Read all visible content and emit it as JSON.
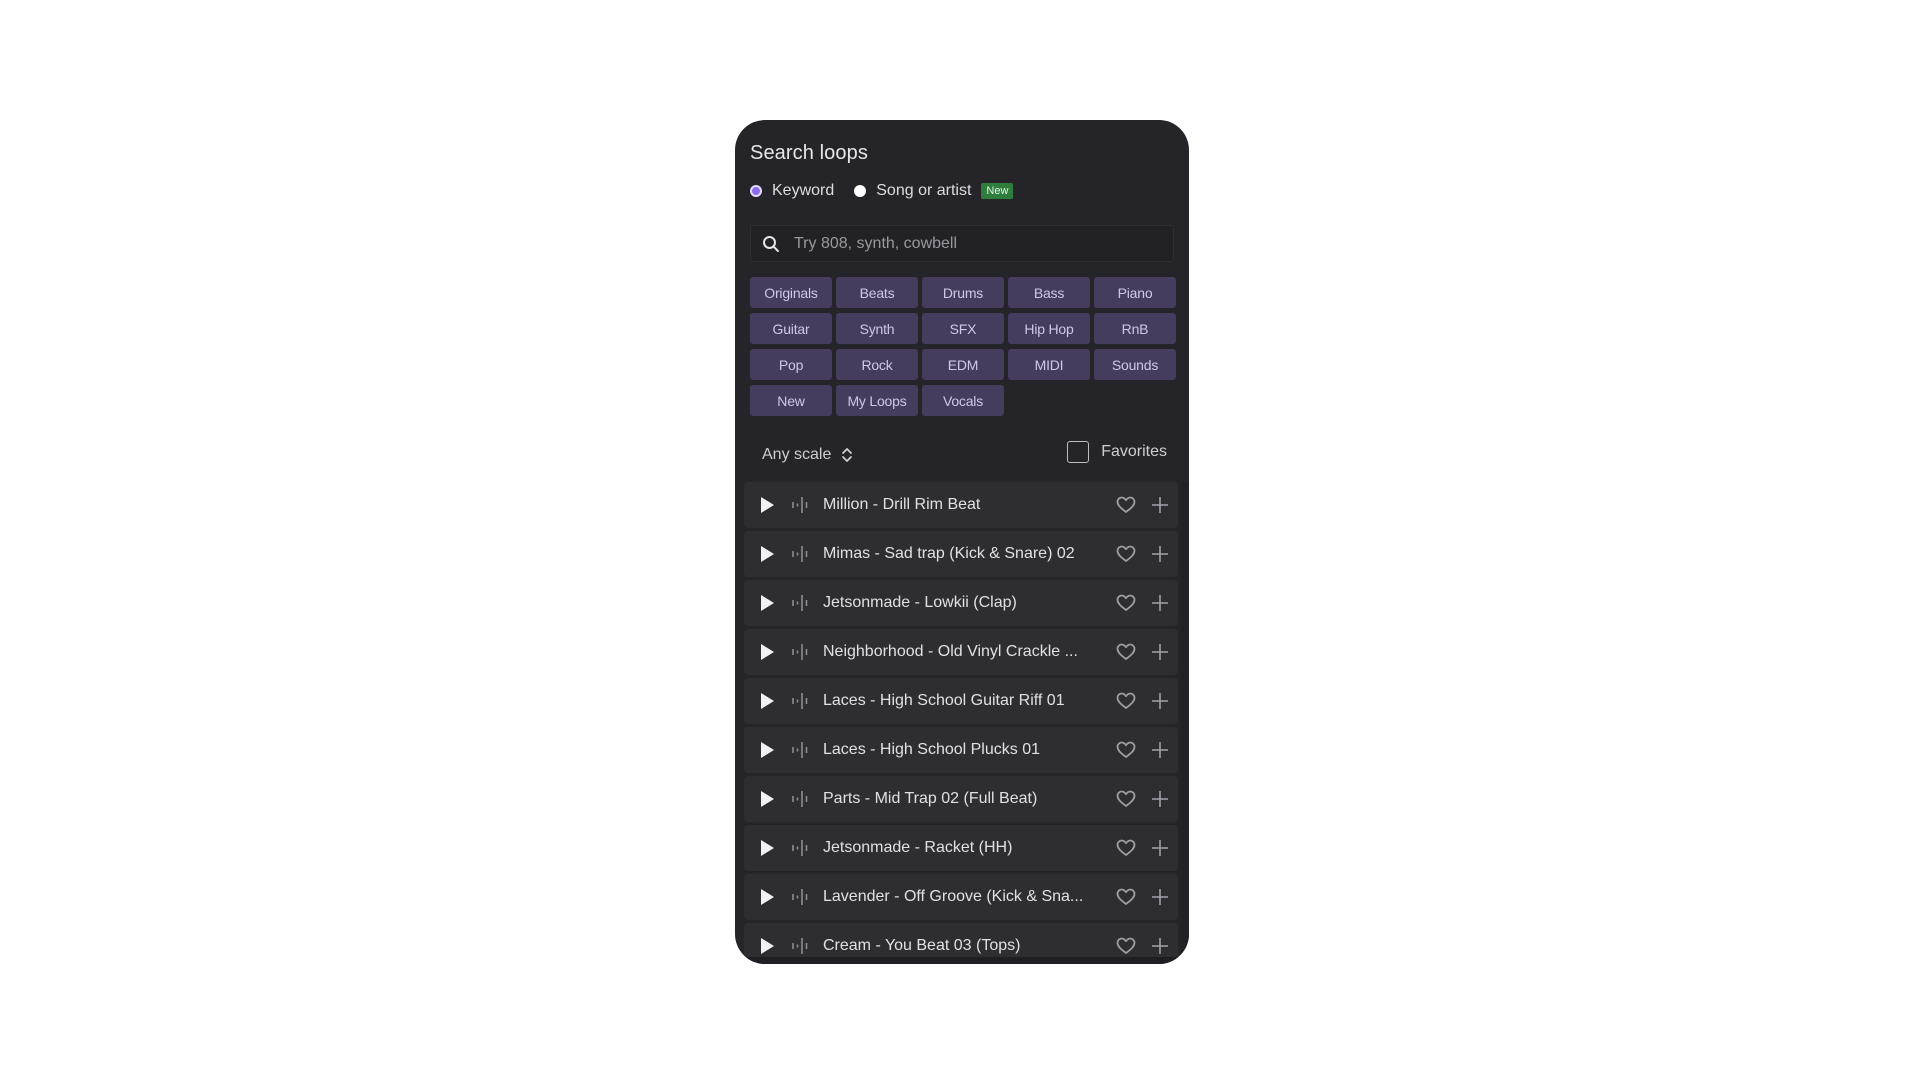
{
  "title": "Search loops",
  "search_mode": {
    "options": [
      {
        "label": "Keyword",
        "selected": true
      },
      {
        "label": "Song or artist",
        "selected": false
      }
    ],
    "new_badge": "New"
  },
  "search": {
    "placeholder": "Try 808, synth, cowbell",
    "value": "",
    "icon": "search-icon"
  },
  "categories": [
    "Originals",
    "Beats",
    "Drums",
    "Bass",
    "Piano",
    "Guitar",
    "Synth",
    "SFX",
    "Hip Hop",
    "RnB",
    "Pop",
    "Rock",
    "EDM",
    "MIDI",
    "Sounds",
    "New",
    "My Loops",
    "Vocals"
  ],
  "filters": {
    "scale_label": "Any scale",
    "favorites_label": "Favorites",
    "favorites_checked": false
  },
  "loops": [
    {
      "name": "Million - Drill Rim Beat"
    },
    {
      "name": "Mimas - Sad trap (Kick & Snare) 02"
    },
    {
      "name": "Jetsonmade - Lowkii (Clap)"
    },
    {
      "name": "Neighborhood - Old Vinyl Crackle ..."
    },
    {
      "name": "Laces - High School Guitar Riff 01"
    },
    {
      "name": "Laces - High School Plucks 01"
    },
    {
      "name": "Parts - Mid Trap 02 (Full Beat)"
    },
    {
      "name": "Jetsonmade - Racket (HH)"
    },
    {
      "name": "Lavender - Off Groove (Kick & Sna..."
    },
    {
      "name": "Cream - You Beat 03 (Tops)"
    }
  ],
  "colors": {
    "panel_bg": "#252429",
    "row_bg": "#2e2d32",
    "chip_bg": "#463d5e",
    "chip_text": "#cfc8e3",
    "accent": "#8b6cf0",
    "badge_bg": "#2f7d3c"
  }
}
